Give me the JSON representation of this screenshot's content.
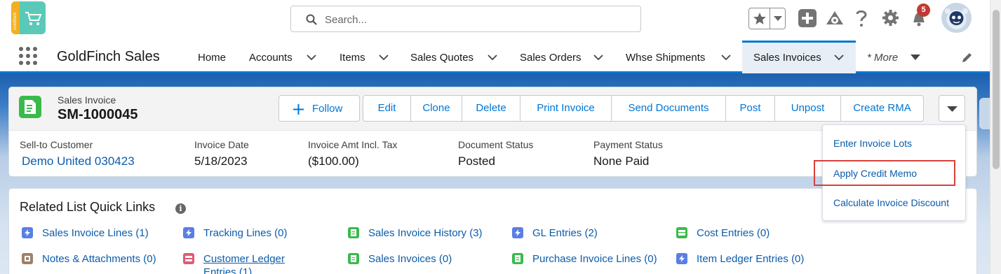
{
  "header": {
    "app_logo_text": "Goldfinch",
    "search_placeholder": "Search...",
    "notification_count": "5"
  },
  "nav": {
    "app_name": "GoldFinch Sales",
    "items": [
      {
        "label": "Home",
        "has_menu": false
      },
      {
        "label": "Accounts",
        "has_menu": true
      },
      {
        "label": "Items",
        "has_menu": true
      },
      {
        "label": "Sales Quotes",
        "has_menu": true
      },
      {
        "label": "Sales Orders",
        "has_menu": true
      },
      {
        "label": "Whse Shipments",
        "has_menu": true
      },
      {
        "label": "Sales Invoices",
        "has_menu": true,
        "active": true
      },
      {
        "label": "* More",
        "has_menu": true
      }
    ]
  },
  "record": {
    "type_label": "Sales Invoice",
    "title": "SM-1000045",
    "follow_label": "Follow",
    "actions": [
      "Edit",
      "Clone",
      "Delete",
      "Print Invoice",
      "Send Documents",
      "Post",
      "Unpost",
      "Create RMA"
    ],
    "fields": [
      {
        "label": "Sell-to Customer",
        "value": "Demo United 030423",
        "link": true
      },
      {
        "label": "Invoice Date",
        "value": "5/18/2023",
        "link": false
      },
      {
        "label": "Invoice Amt Incl. Tax",
        "value": "($100.00)",
        "link": false
      },
      {
        "label": "Document Status",
        "value": "Posted",
        "link": false
      },
      {
        "label": "Payment Status",
        "value": "None Paid",
        "link": false
      }
    ]
  },
  "dropdown": {
    "items": [
      "Enter Invoice Lots",
      "Apply Credit Memo",
      "Calculate Invoice Discount"
    ],
    "highlighted_index": 1
  },
  "related": {
    "title": "Related List Quick Links",
    "info_icon": "i",
    "links": [
      {
        "label": "Sales Invoice Lines (1)",
        "icon": "bolt-icon",
        "color": "#5b7ee5"
      },
      {
        "label": "Tracking Lines (0)",
        "icon": "bolt-icon",
        "color": "#5b7ee5"
      },
      {
        "label": "Sales Invoice History (3)",
        "icon": "document-icon",
        "color": "#3bba4c"
      },
      {
        "label": "GL Entries (2)",
        "icon": "bolt-icon",
        "color": "#5b7ee5"
      },
      {
        "label": "Cost Entries (0)",
        "icon": "ledger-icon",
        "color": "#3bba4c"
      },
      {
        "label": "Notes & Attachments (0)",
        "icon": "file-icon",
        "color": "#a0806a"
      },
      {
        "label": "Customer Ledger Entries (1)",
        "icon": "card-icon",
        "color": "#e05a74"
      },
      {
        "label": "Sales Invoices (0)",
        "icon": "document-icon",
        "color": "#3bba4c"
      },
      {
        "label": "Purchase Invoice Lines (0)",
        "icon": "document-icon",
        "color": "#3bba4c"
      },
      {
        "label": "Item Ledger Entries (0)",
        "icon": "bolt-icon",
        "color": "#5b7ee5"
      }
    ]
  },
  "colors": {
    "brand_blue": "#0176d3",
    "link_blue": "#0b5cab",
    "record_icon_green": "#3bba4c",
    "highlight_red": "#d9403a",
    "badge_red": "#c23934"
  }
}
